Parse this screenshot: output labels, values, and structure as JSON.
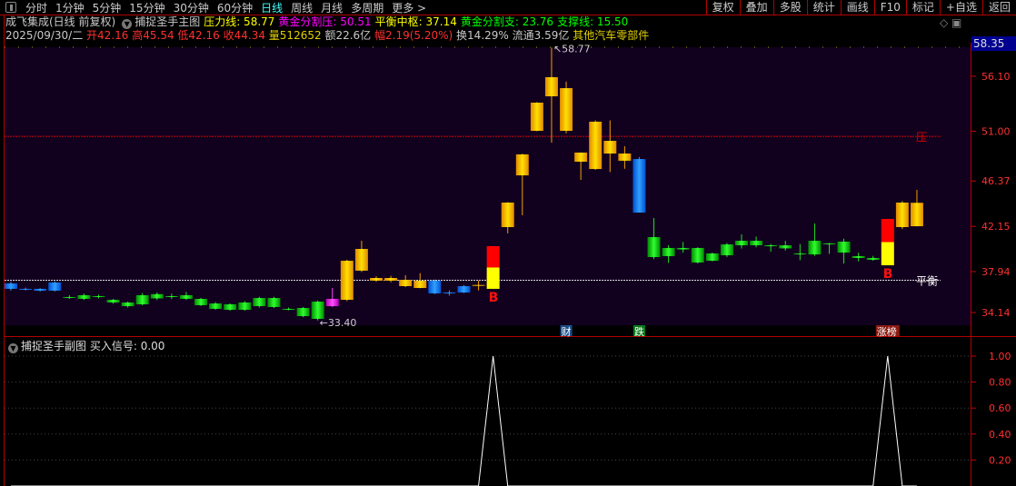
{
  "toolbar": {
    "periods": [
      "分时",
      "1分钟",
      "5分钟",
      "15分钟",
      "30分钟",
      "60分钟",
      "日线",
      "周线",
      "月线",
      "多周期",
      "更多 >"
    ],
    "active": "日线",
    "tools": [
      "复权",
      "叠加",
      "多股",
      "统计",
      "画线",
      "F10",
      "标记",
      "+自选",
      "返回"
    ]
  },
  "header": {
    "stock": "成飞集成(日线 前复权)",
    "indicator": "捕捉圣手主图",
    "lines": [
      {
        "label": "压力线: 58.77",
        "color": "#ffff00"
      },
      {
        "label": "黄金分割压: 50.51",
        "color": "#ff00ff"
      },
      {
        "label": "平衡中枢: 37.14",
        "color": "#ffff00"
      },
      {
        "label": "黄金分割支: 23.76",
        "color": "#00ff00"
      },
      {
        "label": "支撑线: 15.50",
        "color": "#00ff00"
      }
    ]
  },
  "quote": {
    "date": "2025/09/30/二",
    "open": "开42.16",
    "high": "高45.54",
    "low": "低42.16",
    "close": "收44.34",
    "volume": "量512652",
    "amount": "额22.6亿",
    "change": "幅2.19(5.20%)",
    "turnover": "换14.29%",
    "float": "流通3.59亿",
    "sector": "其他汽车零部件"
  },
  "axis": {
    "current": "58.35",
    "ticks": [
      "56.10",
      "51.00",
      "46.37",
      "42.15",
      "37.94",
      "34.14"
    ],
    "tick_values": [
      56.1,
      51.0,
      46.37,
      42.15,
      37.94,
      34.14
    ]
  },
  "annotations": {
    "high": "58.77",
    "low": "33.40",
    "pressure_label": "压",
    "balance_label": "平衡",
    "signal_label": "B",
    "pressure_value": 50.51,
    "balance_value": 37.14
  },
  "events": [
    {
      "label": "财",
      "index": 38,
      "color": "#1a4f8a"
    },
    {
      "label": "跌",
      "index": 43,
      "color": "#0a7a1a"
    },
    {
      "label": "涨榜",
      "index": 60,
      "color": "#8a1a10"
    }
  ],
  "chart_data": {
    "type": "candlestick",
    "ohlc_order": [
      "open",
      "close",
      "high",
      "low"
    ],
    "candles": [
      [
        36.84,
        36.34,
        37.01,
        36.17,
        "blue"
      ],
      [
        36.34,
        36.3,
        36.45,
        36.2,
        "blue"
      ],
      [
        36.34,
        36.17,
        36.4,
        36.1,
        "blue"
      ],
      [
        36.93,
        36.17,
        37.05,
        36.1,
        "blue"
      ],
      [
        35.58,
        35.55,
        35.75,
        35.4,
        "down"
      ],
      [
        35.75,
        35.41,
        35.9,
        35.3,
        "down"
      ],
      [
        35.66,
        35.6,
        35.8,
        35.45,
        "down"
      ],
      [
        35.32,
        35.07,
        35.4,
        34.95,
        "down"
      ],
      [
        35.07,
        34.73,
        35.15,
        34.6,
        "down"
      ],
      [
        34.9,
        35.75,
        35.95,
        34.8,
        "up_green"
      ],
      [
        35.85,
        35.45,
        36.0,
        35.3,
        "down"
      ],
      [
        35.66,
        35.6,
        35.9,
        35.4,
        "down"
      ],
      [
        35.75,
        35.41,
        36.05,
        35.3,
        "down"
      ],
      [
        35.41,
        34.82,
        35.5,
        34.75,
        "down"
      ],
      [
        34.98,
        34.48,
        35.1,
        34.4,
        "down"
      ],
      [
        34.9,
        34.39,
        34.98,
        34.3,
        "down"
      ],
      [
        35.07,
        34.39,
        35.2,
        34.3,
        "down"
      ],
      [
        35.49,
        34.73,
        35.6,
        34.6,
        "down"
      ],
      [
        35.49,
        34.65,
        35.6,
        34.55,
        "down"
      ],
      [
        34.48,
        34.45,
        34.6,
        34.35,
        "down"
      ],
      [
        34.56,
        33.8,
        34.65,
        33.7,
        "down"
      ],
      [
        35.15,
        33.55,
        35.25,
        33.4,
        "down"
      ],
      [
        35.41,
        34.73,
        36.42,
        34.65,
        "magenta"
      ],
      [
        35.32,
        38.95,
        39.05,
        35.2,
        "up"
      ],
      [
        38.03,
        40.05,
        40.81,
        37.9,
        "up"
      ],
      [
        37.1,
        37.35,
        37.5,
        37.0,
        "up"
      ],
      [
        37.1,
        37.35,
        37.55,
        36.95,
        "up"
      ],
      [
        36.59,
        37.18,
        37.6,
        36.5,
        "up"
      ],
      [
        36.42,
        37.1,
        37.8,
        36.4,
        "up"
      ],
      [
        37.1,
        35.92,
        37.2,
        35.85,
        "blue"
      ],
      [
        36.0,
        35.95,
        36.2,
        35.7,
        "blue"
      ],
      [
        36.59,
        36.0,
        36.7,
        35.95,
        "blue"
      ],
      [
        36.68,
        36.7,
        37.1,
        36.2,
        "up"
      ],
      [
        36.34,
        40.31,
        40.31,
        36.34,
        "signal"
      ],
      [
        42.08,
        44.36,
        44.4,
        41.5,
        "up"
      ],
      [
        46.89,
        48.84,
        48.9,
        43.18,
        "up"
      ],
      [
        51.03,
        53.65,
        53.7,
        51.0,
        "up"
      ],
      [
        54.24,
        56.02,
        58.77,
        49.93,
        "up"
      ],
      [
        51.03,
        55.0,
        55.6,
        50.8,
        "up"
      ],
      [
        48.16,
        49.01,
        49.01,
        46.47,
        "up"
      ],
      [
        47.48,
        51.88,
        52.0,
        47.4,
        "up"
      ],
      [
        50.1,
        48.92,
        52.0,
        47.2,
        "up"
      ],
      [
        48.25,
        48.92,
        49.6,
        47.5,
        "up"
      ],
      [
        48.41,
        43.43,
        48.6,
        43.43,
        "blue"
      ],
      [
        41.15,
        39.29,
        42.92,
        39.1,
        "down"
      ],
      [
        40.14,
        39.38,
        40.4,
        38.75,
        "down"
      ],
      [
        40.14,
        40.0,
        40.7,
        39.7,
        "down"
      ],
      [
        40.14,
        38.79,
        40.2,
        38.7,
        "down"
      ],
      [
        39.63,
        38.95,
        39.7,
        38.9,
        "down"
      ],
      [
        40.47,
        39.46,
        40.6,
        39.3,
        "down"
      ],
      [
        40.81,
        40.39,
        41.4,
        40.1,
        "down"
      ],
      [
        40.81,
        40.39,
        41.2,
        40.2,
        "down"
      ],
      [
        40.39,
        40.3,
        40.5,
        39.8,
        "down"
      ],
      [
        40.39,
        40.1,
        40.8,
        39.9,
        "down"
      ],
      [
        39.63,
        39.54,
        40.5,
        39.0,
        "down"
      ],
      [
        40.81,
        39.54,
        42.42,
        39.4,
        "down"
      ],
      [
        40.56,
        40.5,
        40.6,
        39.6,
        "down"
      ],
      [
        40.73,
        39.71,
        41.0,
        38.7,
        "down"
      ],
      [
        39.38,
        39.21,
        39.7,
        38.9,
        "down"
      ],
      [
        39.21,
        39.04,
        39.4,
        38.95,
        "down"
      ],
      [
        38.53,
        42.84,
        42.84,
        38.53,
        "signal"
      ],
      [
        42.08,
        44.36,
        44.5,
        41.9,
        "up"
      ],
      [
        42.16,
        44.34,
        45.54,
        42.16,
        "up"
      ]
    ],
    "sub": {
      "title": "捕捉圣手副图",
      "series_name": "买入信号: 0.00",
      "ticks": [
        "1.00",
        "0.80",
        "0.60",
        "0.40",
        "0.20"
      ],
      "tick_values": [
        1,
        0.8,
        0.6,
        0.4,
        0.2
      ],
      "signal_indices": [
        33,
        60
      ],
      "ylim": [
        0,
        1
      ]
    }
  }
}
